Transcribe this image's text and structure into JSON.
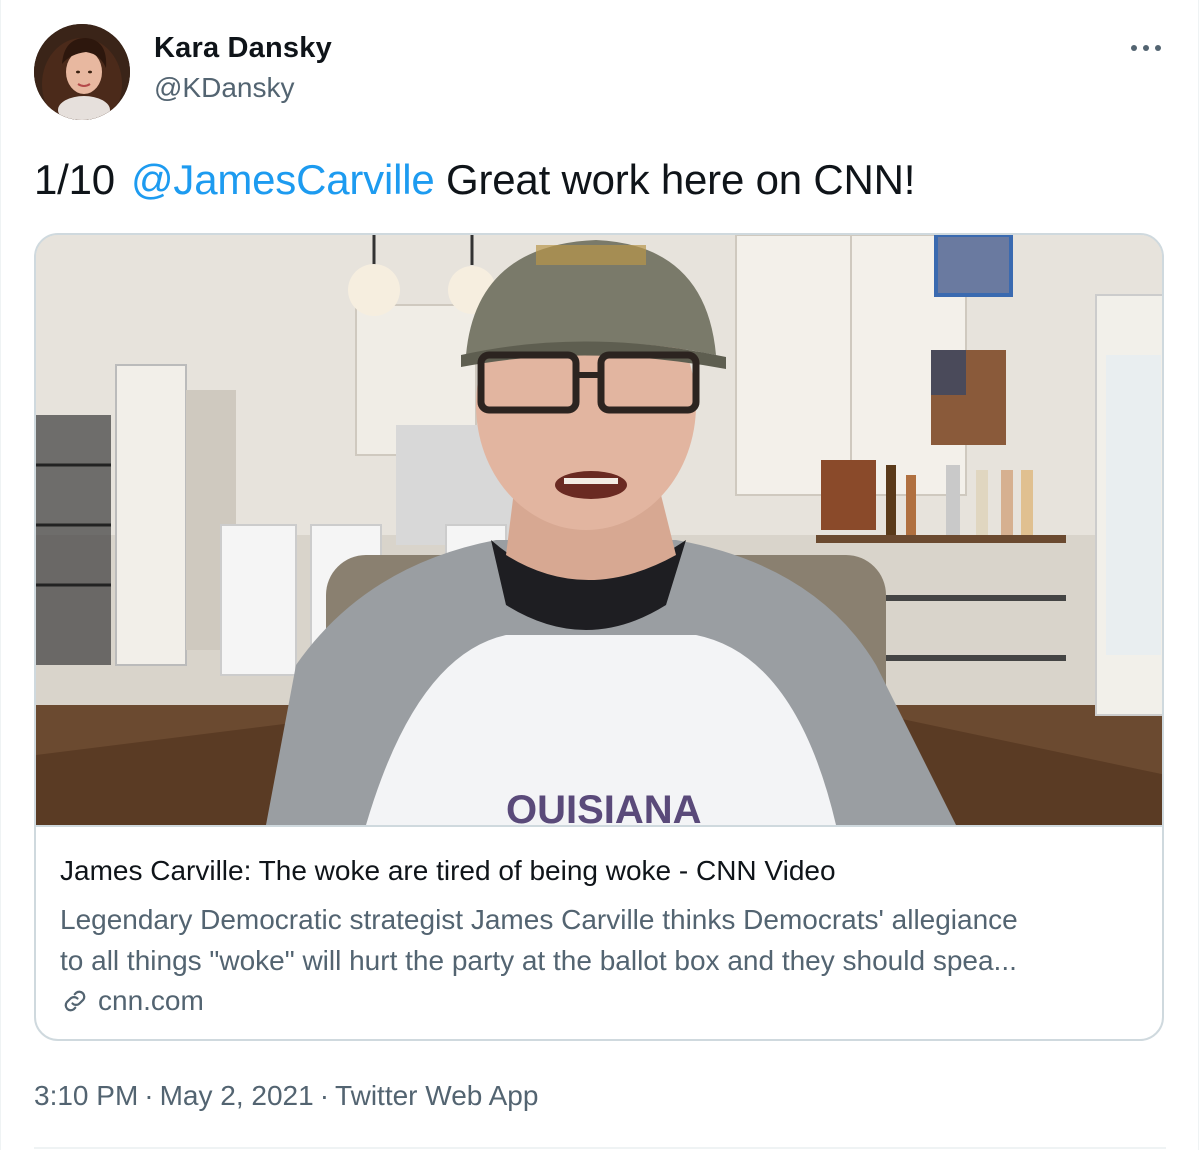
{
  "author": {
    "display_name": "Kara Dansky",
    "handle": "@KDansky"
  },
  "tweet": {
    "prefix": "1/10",
    "mention": "@JamesCarville",
    "text": " Great work here on CNN!"
  },
  "link_card": {
    "title": "James Carville: The woke are tired of being woke - CNN Video",
    "description_line1": "Legendary Democratic strategist James Carville thinks Democrats' allegiance",
    "description_line2": "to all things \"woke\" will hurt the party at the ballot box and they should spea...",
    "domain": "cnn.com",
    "image_alt": "James Carville speaking on video from his kitchen"
  },
  "meta": {
    "time": "3:10 PM",
    "date": "May 2, 2021",
    "source": "Twitter Web App",
    "separator": "·"
  },
  "icons": {
    "more": "more-options-icon",
    "link": "link-icon"
  },
  "colors": {
    "link_blue": "#1d9bf0",
    "secondary_text": "#536471",
    "border": "#cfd9de"
  }
}
